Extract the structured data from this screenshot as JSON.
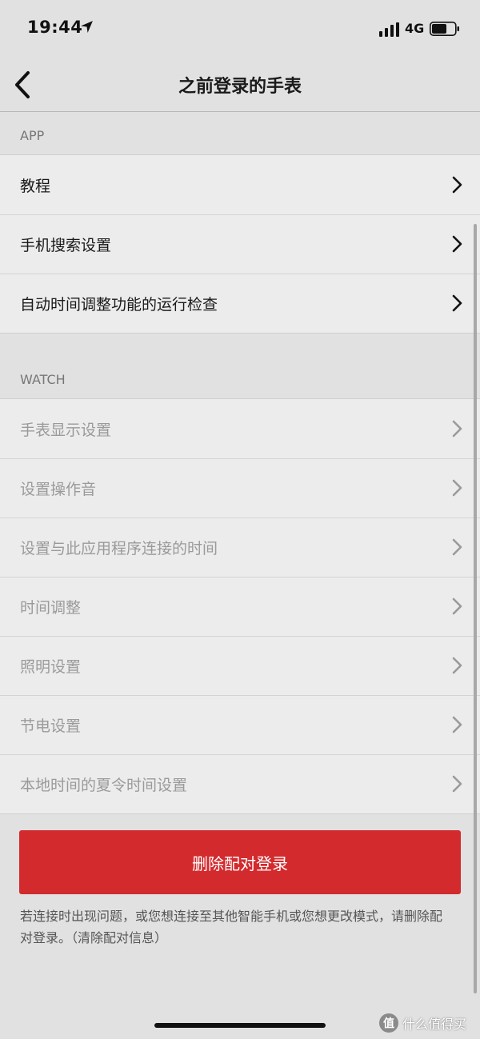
{
  "status_bar": {
    "time": "19:44",
    "network": "4G"
  },
  "nav": {
    "title": "之前登录的手表"
  },
  "app_section": {
    "header": "APP",
    "items": [
      {
        "label": "教程"
      },
      {
        "label": "手机搜索设置"
      },
      {
        "label": "自动时间调整功能的运行检查"
      }
    ]
  },
  "watch_section": {
    "header": "WATCH",
    "items": [
      {
        "label": "手表显示设置"
      },
      {
        "label": "设置操作音"
      },
      {
        "label": "设置与此应用程序连接的时间"
      },
      {
        "label": "时间调整"
      },
      {
        "label": "照明设置"
      },
      {
        "label": "节电设置"
      },
      {
        "label": "本地时间的夏令时间设置"
      }
    ]
  },
  "delete_button": {
    "label": "删除配对登录"
  },
  "help_text": "若连接时出现问题，或您想连接至其他智能手机或您想更改模式，请删除配对登录。（清除配对信息）",
  "watermark": {
    "text": "什么值得买",
    "logo": "值"
  },
  "colors": {
    "accent": "#d32a2d",
    "background": "#e1e1e1",
    "list_background": "#ececec"
  }
}
